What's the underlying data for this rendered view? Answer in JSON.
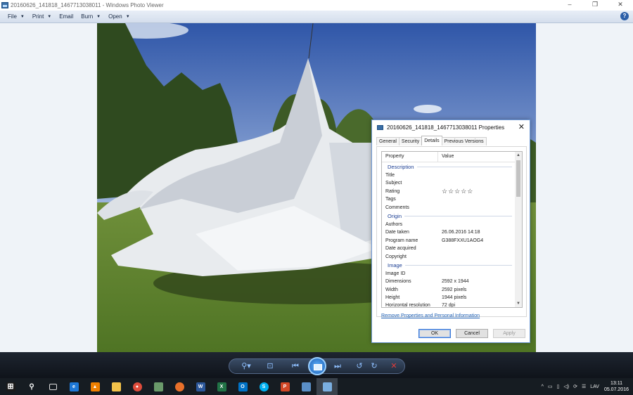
{
  "window": {
    "title": "20160626_141818_1467713038011 - Windows Photo Viewer",
    "minimize": "–",
    "maximize": "❐",
    "close": "✕"
  },
  "menu": {
    "items": [
      {
        "label": "File",
        "caret": "▼"
      },
      {
        "label": "Print",
        "caret": "▼"
      },
      {
        "label": "Email",
        "caret": ""
      },
      {
        "label": "Burn",
        "caret": "▼"
      },
      {
        "label": "Open",
        "caret": "▼"
      }
    ],
    "help": "?"
  },
  "dialog": {
    "title": "20160626_141818_1467713038011 Properties",
    "close": "✕",
    "tabs": [
      "General",
      "Security",
      "Details",
      "Previous Versions"
    ],
    "active_tab": "Details",
    "columns": {
      "property": "Property",
      "value": "Value"
    },
    "groups": {
      "description": {
        "label": "Description",
        "rows": [
          {
            "k": "Title",
            "v": ""
          },
          {
            "k": "Subject",
            "v": ""
          },
          {
            "k": "Rating",
            "v": ""
          },
          {
            "k": "Tags",
            "v": ""
          },
          {
            "k": "Comments",
            "v": ""
          }
        ]
      },
      "origin": {
        "label": "Origin",
        "rows": [
          {
            "k": "Authors",
            "v": ""
          },
          {
            "k": "Date taken",
            "v": "26.06.2016 14:18"
          },
          {
            "k": "Program name",
            "v": "G388FXXU1AOG4"
          },
          {
            "k": "Date acquired",
            "v": ""
          },
          {
            "k": "Copyright",
            "v": ""
          }
        ]
      },
      "image": {
        "label": "Image",
        "rows": [
          {
            "k": "Image ID",
            "v": ""
          },
          {
            "k": "Dimensions",
            "v": "2592 x 1944"
          },
          {
            "k": "Width",
            "v": "2592 pixels"
          },
          {
            "k": "Height",
            "v": "1944 pixels"
          },
          {
            "k": "Horizontal resolution",
            "v": "72 dpi"
          }
        ]
      }
    },
    "rating_stars": "☆☆☆☆☆",
    "rating_value": 0,
    "remove_link": "Remove Properties and Personal Information",
    "buttons": {
      "ok": "OK",
      "cancel": "Cancel",
      "apply": "Apply"
    }
  },
  "toolbar": {
    "zoom_icon": "zoom-icon",
    "actual_size_icon": "actual-size-icon",
    "previous_icon": "previous-icon",
    "slideshow_icon": "slideshow-icon",
    "next_icon": "next-icon",
    "rotate_ccw_icon": "rotate-counterclockwise-icon",
    "rotate_cw_icon": "rotate-clockwise-icon",
    "delete_icon": "delete-icon"
  },
  "taskbar": {
    "language": "LAV",
    "time": "13:11",
    "date": "05.07.2016"
  }
}
